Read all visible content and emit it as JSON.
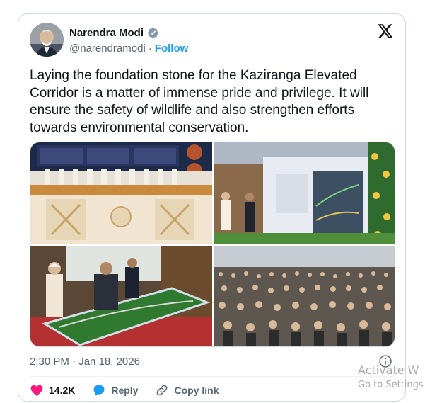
{
  "author": {
    "name": "Narendra Modi",
    "handle": "@narendramodi",
    "separator": "·",
    "follow_label": "Follow"
  },
  "tweet": {
    "text": "Laying the foundation stone for the Kaziranga Elevated Corridor is a matter of immense pride and privilege. It will ensure the safety of wildlife and also strengthen efforts towards environmental conservation.",
    "timestamp": "2:30 PM · Jan 18, 2026"
  },
  "photos": [
    {
      "name": "stage-ceremony-photo"
    },
    {
      "name": "exhibition-map-photo"
    },
    {
      "name": "corridor-model-photo"
    },
    {
      "name": "crowd-photo"
    }
  ],
  "actions": {
    "likes_count": "14.2K",
    "reply_label": "Reply",
    "copy_link_label": "Copy link"
  },
  "icons": {
    "verified": "verified-badge-icon",
    "x_logo": "x-logo-icon",
    "info": "info-icon",
    "heart": "heart-icon",
    "reply": "reply-bubble-icon",
    "link": "link-icon"
  },
  "colors": {
    "link_blue": "#1d9bf0",
    "heart_pink": "#f91880",
    "text_primary": "#0f1419",
    "text_secondary": "#536471",
    "border": "#cfd9de"
  },
  "watermark": {
    "line1": "Activate W",
    "line2": "Go to Settings"
  }
}
